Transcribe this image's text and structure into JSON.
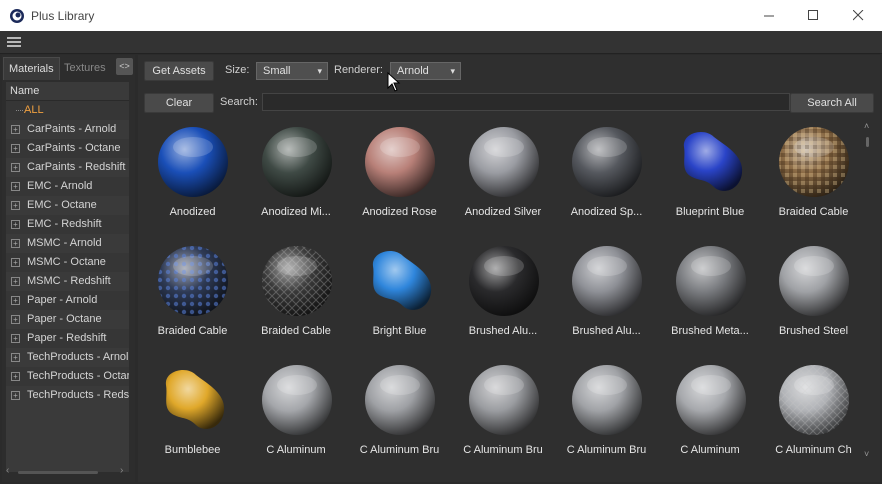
{
  "window": {
    "title": "Plus Library"
  },
  "tabs": {
    "materials": "Materials",
    "textures": "Textures"
  },
  "tree": {
    "header": "Name",
    "items": [
      {
        "label": "ALL",
        "selected": true
      },
      {
        "label": "CarPaints - Arnold"
      },
      {
        "label": "CarPaints - Octane"
      },
      {
        "label": "CarPaints - Redshift"
      },
      {
        "label": "EMC - Arnold"
      },
      {
        "label": "EMC - Octane"
      },
      {
        "label": "EMC - Redshift"
      },
      {
        "label": "MSMC - Arnold"
      },
      {
        "label": "MSMC - Octane"
      },
      {
        "label": "MSMC - Redshift"
      },
      {
        "label": "Paper - Arnold"
      },
      {
        "label": "Paper - Octane"
      },
      {
        "label": "Paper - Redshift"
      },
      {
        "label": "TechProducts - Arnol"
      },
      {
        "label": "TechProducts - Octar"
      },
      {
        "label": "TechProducts - Redsl"
      }
    ]
  },
  "toolbar": {
    "get_assets": "Get Assets",
    "size_label": "Size:",
    "size_value": "Small",
    "renderer_label": "Renderer:",
    "renderer_value": "Arnold",
    "clear": "Clear",
    "search_label": "Search:",
    "search_value": "",
    "search_all": "Search All"
  },
  "materials": [
    {
      "name": "Anodized",
      "kind": "sphere",
      "color": "#1a4fb8",
      "pattern": "none"
    },
    {
      "name": "Anodized Mi...",
      "kind": "sphere",
      "color": "#3f4a45",
      "pattern": "none"
    },
    {
      "name": "Anodized Rose",
      "kind": "sphere",
      "color": "#b88078",
      "pattern": "none"
    },
    {
      "name": "Anodized Silver",
      "kind": "sphere",
      "color": "#9a9ca2",
      "pattern": "none"
    },
    {
      "name": "Anodized Sp...",
      "kind": "sphere",
      "color": "#55585e",
      "pattern": "none"
    },
    {
      "name": "Blueprint Blue",
      "kind": "blob",
      "color": "#2a44c8",
      "pattern": "none"
    },
    {
      "name": "Braided Cable",
      "kind": "sphere",
      "color": "#8a6a45",
      "pattern": "weave"
    },
    {
      "name": "Braided Cable",
      "kind": "sphere",
      "color": "#2e3a55",
      "pattern": "dots"
    },
    {
      "name": "Braided Cable",
      "kind": "sphere",
      "color": "#3a3a3a",
      "pattern": "mesh"
    },
    {
      "name": "Bright Blue",
      "kind": "blob",
      "color": "#2f86dc",
      "pattern": "none"
    },
    {
      "name": "Brushed Alu...",
      "kind": "sphere",
      "color": "#2a2a2c",
      "pattern": "none"
    },
    {
      "name": "Brushed Alu...",
      "kind": "sphere",
      "color": "#8e9096",
      "pattern": "none"
    },
    {
      "name": "Brushed Meta...",
      "kind": "sphere",
      "color": "#7a7c80",
      "pattern": "none"
    },
    {
      "name": "Brushed Steel",
      "kind": "sphere",
      "color": "#9fa1a5",
      "pattern": "none"
    },
    {
      "name": "Bumblebee",
      "kind": "blob",
      "color": "#e0a82a",
      "pattern": "none"
    },
    {
      "name": "C Aluminum",
      "kind": "sphere",
      "color": "#a4a6aa",
      "pattern": "none"
    },
    {
      "name": "C Aluminum Bru",
      "kind": "sphere",
      "color": "#9ea0a4",
      "pattern": "none"
    },
    {
      "name": "C Aluminum Bru",
      "kind": "sphere",
      "color": "#9a9ca0",
      "pattern": "none"
    },
    {
      "name": "C Aluminum Bru",
      "kind": "sphere",
      "color": "#a0a2a6",
      "pattern": "none"
    },
    {
      "name": "C Aluminum",
      "kind": "sphere",
      "color": "#a6a8ac",
      "pattern": "none"
    },
    {
      "name": "C Aluminum Ch",
      "kind": "sphere",
      "color": "#b0b2b6",
      "pattern": "mesh"
    }
  ]
}
